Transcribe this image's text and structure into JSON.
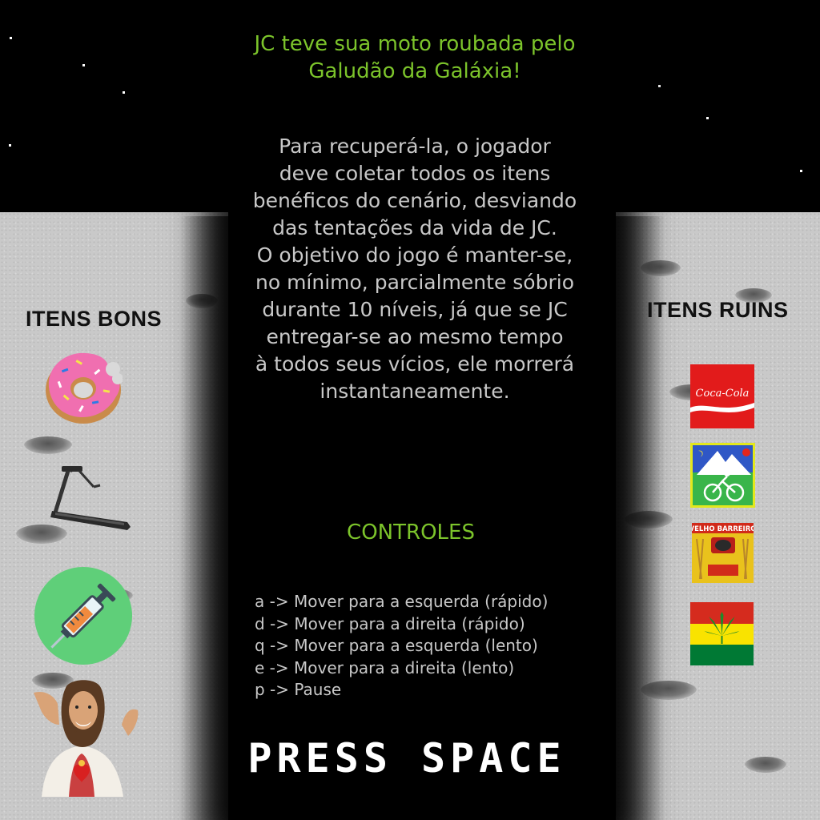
{
  "intro": {
    "line1": "JC teve sua moto roubada pelo",
    "line2": "Galudão da Galáxia!"
  },
  "story": {
    "lines": [
      "Para recuperá-la, o jogador",
      "deve coletar todos os itens",
      "benéficos do cenário, desviando",
      "das tentações da vida de JC.",
      "O objetivo do jogo é manter-se,",
      "no mínimo, parcialmente sóbrio",
      "durante 10 níveis, já que se JC",
      "entregar-se ao mesmo tempo",
      "à todos seus vícios, ele morrerá",
      "instantaneamente."
    ]
  },
  "good_items": {
    "title": "ITENS BONS",
    "icons": [
      "donut-icon",
      "treadmill-icon",
      "syringe-icon",
      "buddy-christ-icon"
    ]
  },
  "bad_items": {
    "title": "ITENS RUINS",
    "icons": [
      "coca-cola-icon",
      "bicycle-day-icon",
      "velho-barreiro-icon",
      "cannabis-flag-icon"
    ],
    "coke_label": "Coca-Cola",
    "velho_label": "VELHO BARREIRO"
  },
  "controls": {
    "title": "CONTROLES",
    "items": [
      "a -> Mover para a esquerda (rápido)",
      "d -> Mover para a direita (rápido)",
      "q -> Mover para a esquerda (lento)",
      "e -> Mover para a direita (lento)",
      "p -> Pause"
    ]
  },
  "prompt": "PRESS SPACE",
  "colors": {
    "accent_green": "#7cc42b",
    "body_text": "#c8c8c8",
    "background": "#000000",
    "moon": "#c9c9c9"
  }
}
